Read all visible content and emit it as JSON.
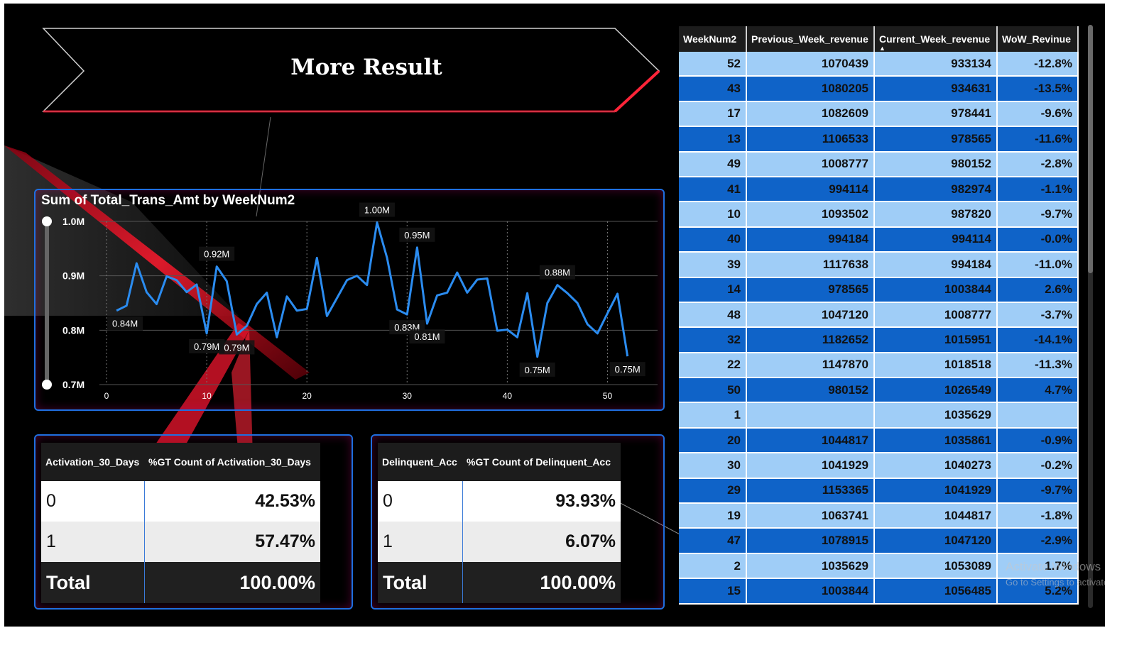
{
  "banner": {
    "title": "More Result"
  },
  "chart_data": {
    "type": "line",
    "title": "Sum of Total_Trans_Amt by WeekNum2",
    "xlabel": "",
    "ylabel": "",
    "x_ticks": [
      "0",
      "10",
      "20",
      "30",
      "40",
      "50"
    ],
    "y_ticks": [
      "1.0M",
      "0.9M",
      "0.8M",
      "0.7M"
    ],
    "xlim": [
      0,
      55
    ],
    "ylim": [
      0.7,
      1.0
    ],
    "series": [
      {
        "x": [
          1,
          2,
          3,
          4,
          5,
          6,
          7,
          8,
          9,
          10,
          11,
          12,
          13,
          14,
          15,
          16,
          17,
          18,
          19,
          20,
          21,
          22,
          23,
          24,
          25,
          26,
          27,
          28,
          29,
          30,
          31,
          32,
          33,
          34,
          35,
          36,
          37,
          38,
          39,
          40,
          41,
          42,
          43,
          44,
          45,
          46,
          47,
          48,
          49,
          50,
          51,
          52
        ],
        "y": [
          0.836,
          0.845,
          0.923,
          0.87,
          0.848,
          0.899,
          0.892,
          0.87,
          0.884,
          0.794,
          0.917,
          0.89,
          0.792,
          0.808,
          0.848,
          0.869,
          0.787,
          0.862,
          0.836,
          0.839,
          0.933,
          0.826,
          0.859,
          0.892,
          0.9,
          0.883,
          0.998,
          0.933,
          0.838,
          0.829,
          0.952,
          0.812,
          0.864,
          0.869,
          0.906,
          0.869,
          0.893,
          0.895,
          0.799,
          0.801,
          0.787,
          0.868,
          0.751,
          0.85,
          0.883,
          0.868,
          0.85,
          0.811,
          0.794,
          0.831,
          0.867,
          0.752
        ]
      }
    ],
    "data_labels": [
      {
        "x": 1,
        "y": 0.836,
        "text": "0.84M"
      },
      {
        "x": 10,
        "y": 0.794,
        "text": "0.79M"
      },
      {
        "x": 11,
        "y": 0.917,
        "text": "0.92M"
      },
      {
        "x": 13,
        "y": 0.792,
        "text": "0.79M"
      },
      {
        "x": 27,
        "y": 0.998,
        "text": "1.00M"
      },
      {
        "x": 30,
        "y": 0.829,
        "text": "0.83M"
      },
      {
        "x": 31,
        "y": 0.952,
        "text": "0.95M"
      },
      {
        "x": 32,
        "y": 0.812,
        "text": "0.81M"
      },
      {
        "x": 43,
        "y": 0.751,
        "text": "0.75M"
      },
      {
        "x": 45,
        "y": 0.883,
        "text": "0.88M"
      },
      {
        "x": 52,
        "y": 0.752,
        "text": "0.75M"
      }
    ],
    "grid": true,
    "line_color": "#2b8cf0"
  },
  "activation_table": {
    "headers": [
      "Activation_30_Days",
      "%GT Count of Activation_30_Days"
    ],
    "rows": [
      {
        "label": "0",
        "value": "42.53%"
      },
      {
        "label": "1",
        "value": "57.47%"
      }
    ],
    "total": {
      "label": "Total",
      "value": "100.00%"
    }
  },
  "delinquent_table": {
    "headers": [
      "Delinquent_Acc",
      "%GT Count of Delinquent_Acc"
    ],
    "rows": [
      {
        "label": "0",
        "value": "93.93%"
      },
      {
        "label": "1",
        "value": "6.07%"
      }
    ],
    "total": {
      "label": "Total",
      "value": "100.00%"
    }
  },
  "week_table": {
    "headers": [
      "WeekNum2",
      "Previous_Week_revenue",
      "Current_Week_revenue",
      "WoW_Revinue"
    ],
    "sort_column": "Current_Week_revenue",
    "rows": [
      [
        "52",
        "1070439",
        "933134",
        "-12.8%"
      ],
      [
        "43",
        "1080205",
        "934631",
        "-13.5%"
      ],
      [
        "17",
        "1082609",
        "978441",
        "-9.6%"
      ],
      [
        "13",
        "1106533",
        "978565",
        "-11.6%"
      ],
      [
        "49",
        "1008777",
        "980152",
        "-2.8%"
      ],
      [
        "41",
        "994114",
        "982974",
        "-1.1%"
      ],
      [
        "10",
        "1093502",
        "987820",
        "-9.7%"
      ],
      [
        "40",
        "994184",
        "994114",
        "-0.0%"
      ],
      [
        "39",
        "1117638",
        "994184",
        "-11.0%"
      ],
      [
        "14",
        "978565",
        "1003844",
        "2.6%"
      ],
      [
        "48",
        "1047120",
        "1008777",
        "-3.7%"
      ],
      [
        "32",
        "1182652",
        "1015951",
        "-14.1%"
      ],
      [
        "22",
        "1147870",
        "1018518",
        "-11.3%"
      ],
      [
        "50",
        "980152",
        "1026549",
        "4.7%"
      ],
      [
        "1",
        "",
        "1035629",
        ""
      ],
      [
        "20",
        "1044817",
        "1035861",
        "-0.9%"
      ],
      [
        "30",
        "1041929",
        "1040273",
        "-0.2%"
      ],
      [
        "29",
        "1153365",
        "1041929",
        "-9.7%"
      ],
      [
        "19",
        "1063741",
        "1044817",
        "-1.8%"
      ],
      [
        "47",
        "1078915",
        "1047120",
        "-2.9%"
      ],
      [
        "2",
        "1035629",
        "1053089",
        "1.7%"
      ],
      [
        "15",
        "1003844",
        "1056485",
        "5.2%"
      ]
    ]
  },
  "watermark": {
    "line1": "Activate Windows",
    "line2": "Go to Settings to activate Windows."
  },
  "colors": {
    "accent_blue": "#1f6fe0",
    "light_row": "#9fcdf7",
    "dark_row": "#0f63c8",
    "red": "#e0142a"
  }
}
